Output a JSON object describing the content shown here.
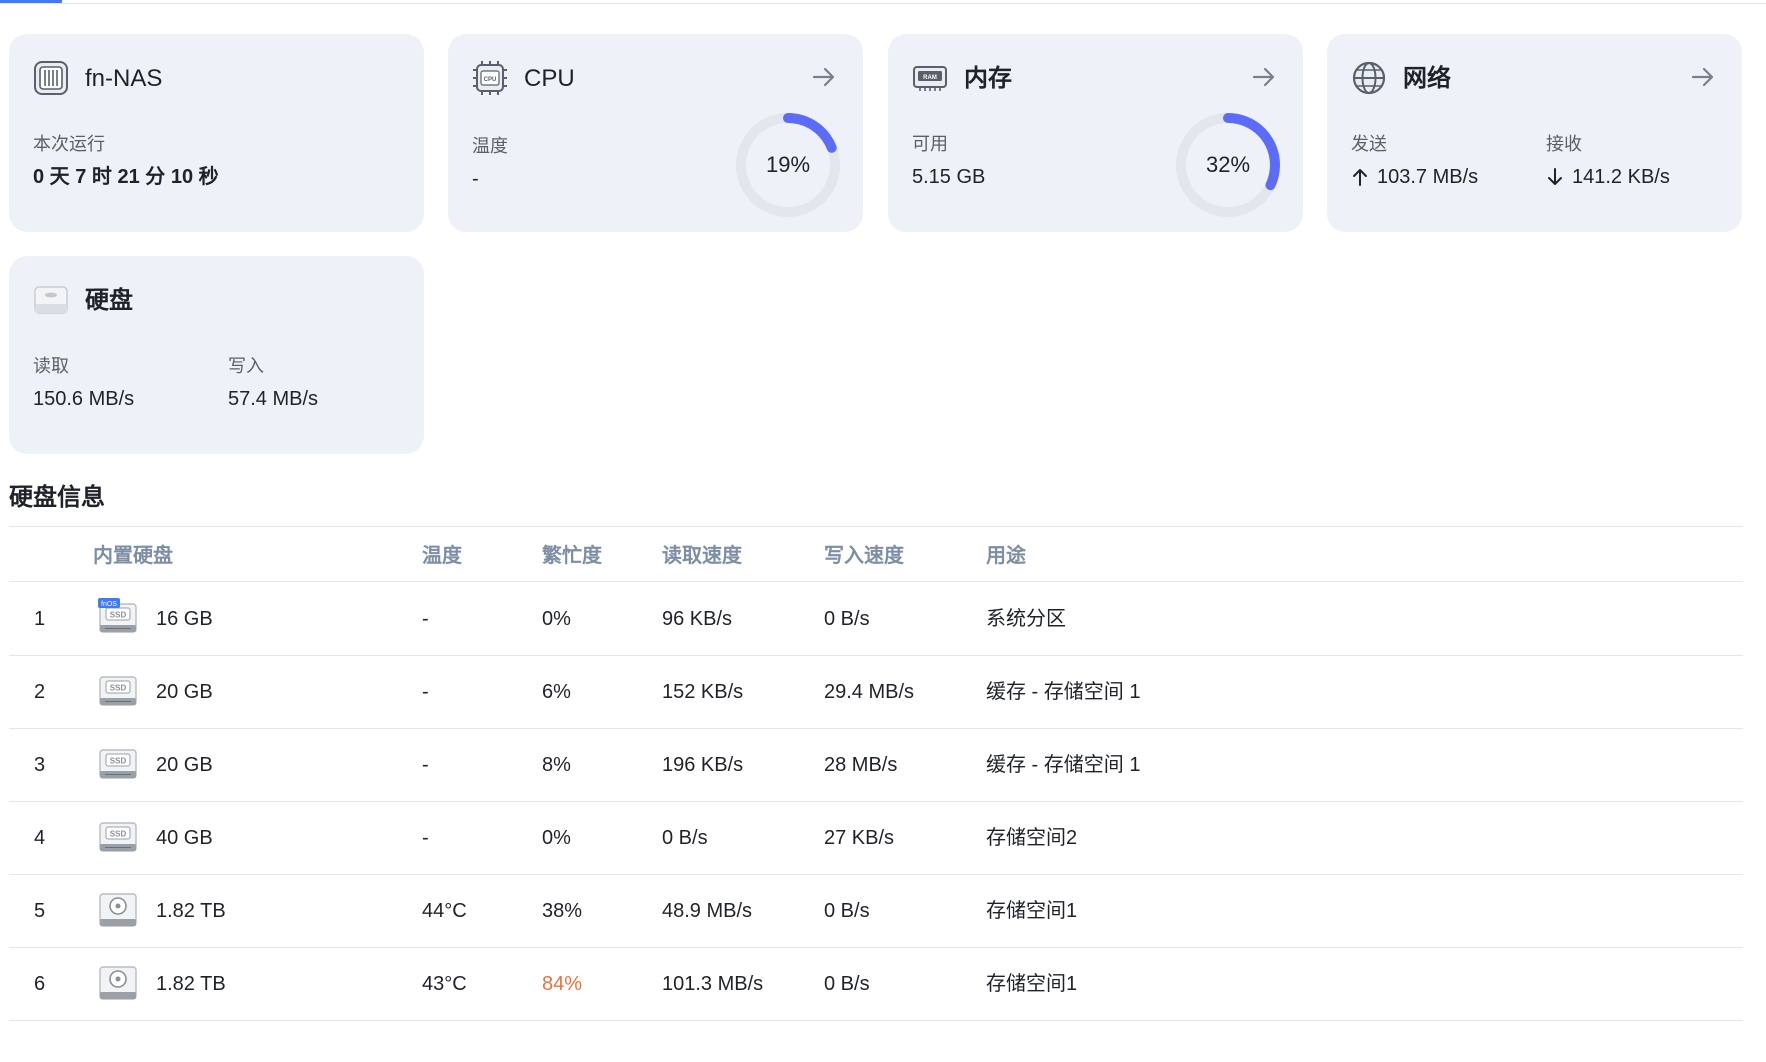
{
  "cards": {
    "system": {
      "title": "fn-NAS",
      "label": "本次运行",
      "value": "0 天 7 时 21 分 10 秒",
      "icon": "server-chip-icon"
    },
    "cpu": {
      "title": "CPU",
      "label": "温度",
      "value": "-",
      "percent_text": "19%",
      "percent": 19,
      "icon": "cpu-chip-icon",
      "accent": "#5b6cf9"
    },
    "memory": {
      "title": "内存",
      "label": "可用",
      "value": "5.15 GB",
      "percent_text": "32%",
      "percent": 32,
      "icon": "ram-chip-icon",
      "accent": "#5b6cf9"
    },
    "network": {
      "title": "网络",
      "send_label": "发送",
      "send_value": "103.7 MB/s",
      "recv_label": "接收",
      "recv_value": "141.2 KB/s",
      "icon": "globe-icon"
    },
    "disk": {
      "title": "硬盘",
      "read_label": "读取",
      "read_value": "150.6 MB/s",
      "write_label": "写入",
      "write_value": "57.4 MB/s",
      "icon": "hard-disk-icon"
    }
  },
  "disk_info": {
    "title": "硬盘信息",
    "columns": [
      "内置硬盘",
      "温度",
      "繁忙度",
      "读取速度",
      "写入速度",
      "用途"
    ],
    "rows": [
      {
        "index": "1",
        "type": "ssd",
        "badge": "fnOS",
        "size": "16 GB",
        "temp": "-",
        "busy": "0%",
        "read": "96 KB/s",
        "write": "0 B/s",
        "usage": "系统分区",
        "busy_hot": false
      },
      {
        "index": "2",
        "type": "ssd",
        "badge": "",
        "size": "20 GB",
        "temp": "-",
        "busy": "6%",
        "read": "152 KB/s",
        "write": "29.4 MB/s",
        "usage": "缓存 - 存储空间 1",
        "busy_hot": false
      },
      {
        "index": "3",
        "type": "ssd",
        "badge": "",
        "size": "20 GB",
        "temp": "-",
        "busy": "8%",
        "read": "196 KB/s",
        "write": "28 MB/s",
        "usage": "缓存 - 存储空间 1",
        "busy_hot": false
      },
      {
        "index": "4",
        "type": "ssd",
        "badge": "",
        "size": "40 GB",
        "temp": "-",
        "busy": "0%",
        "read": "0 B/s",
        "write": "27 KB/s",
        "usage": "存储空间2",
        "busy_hot": false
      },
      {
        "index": "5",
        "type": "hdd",
        "badge": "",
        "size": "1.82 TB",
        "temp": "44°C",
        "busy": "38%",
        "read": "48.9 MB/s",
        "write": "0 B/s",
        "usage": "存储空间1",
        "busy_hot": false
      },
      {
        "index": "6",
        "type": "hdd",
        "badge": "",
        "size": "1.82 TB",
        "temp": "43°C",
        "busy": "84%",
        "read": "101.3 MB/s",
        "write": "0 B/s",
        "usage": "存储空间1",
        "busy_hot": true
      }
    ],
    "ssd_label": "SSD",
    "hot_color": "#e8733c"
  },
  "icon_text": {
    "cpu": "CPU",
    "ram": "RAM"
  }
}
